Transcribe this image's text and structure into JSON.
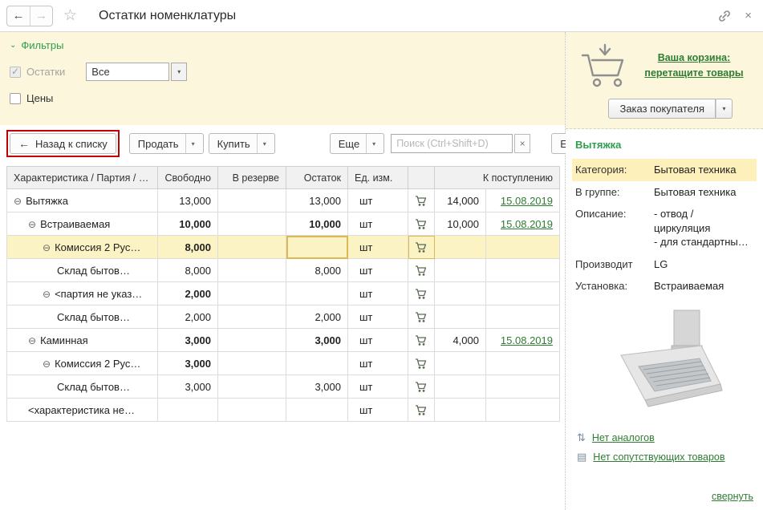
{
  "topbar": {
    "title": "Остатки номенклатуры"
  },
  "filters": {
    "title": "Фильтры",
    "remainders_label": "Остатки",
    "remainders_value": "Все",
    "prices_label": "Цены"
  },
  "toolbar": {
    "back_button": "Назад к списку",
    "sell_button": "Продать",
    "buy_button": "Купить",
    "more_button": "Еще",
    "search_placeholder": "Поиск (Ctrl+Shift+D)",
    "more_button_2": "Еще"
  },
  "table": {
    "columns": {
      "name": "Характеристика / Партия / …",
      "free": "Свободно",
      "reserve": "В резерве",
      "rest": "Остаток",
      "unit": "Ед. изм.",
      "incoming": "К поступлению"
    },
    "rows": [
      {
        "name": "Вытяжка",
        "free": "13,000",
        "reserve": "",
        "rest": "13,000",
        "unit": "шт",
        "incoming": "14,000",
        "date": "15.08.2019"
      },
      {
        "name": "Встраиваемая",
        "free": "10,000",
        "reserve": "",
        "rest": "10,000",
        "unit": "шт",
        "incoming": "10,000",
        "date": "15.08.2019"
      },
      {
        "name": "Комиссия 2 Рус…",
        "free": "8,000",
        "reserve": "",
        "rest": "",
        "unit": "шт",
        "incoming": "",
        "date": ""
      },
      {
        "name": "Склад бытов…",
        "free": "8,000",
        "reserve": "",
        "rest": "8,000",
        "unit": "шт",
        "incoming": "",
        "date": ""
      },
      {
        "name": "<партия не указ…",
        "free": "2,000",
        "reserve": "",
        "rest": "",
        "unit": "шт",
        "incoming": "",
        "date": ""
      },
      {
        "name": "Склад бытов…",
        "free": "2,000",
        "reserve": "",
        "rest": "2,000",
        "unit": "шт",
        "incoming": "",
        "date": ""
      },
      {
        "name": "Каминная",
        "free": "3,000",
        "reserve": "",
        "rest": "3,000",
        "unit": "шт",
        "incoming": "4,000",
        "date": "15.08.2019"
      },
      {
        "name": "Комиссия 2 Рус…",
        "free": "3,000",
        "reserve": "",
        "rest": "",
        "unit": "шт",
        "incoming": "",
        "date": ""
      },
      {
        "name": "Склад бытов…",
        "free": "3,000",
        "reserve": "",
        "rest": "3,000",
        "unit": "шт",
        "incoming": "",
        "date": ""
      },
      {
        "name": "<характеристика не…",
        "free": "",
        "reserve": "",
        "rest": "",
        "unit": "шт",
        "incoming": "",
        "date": ""
      }
    ]
  },
  "cart_panel": {
    "link_line_1": "Ваша корзина:",
    "link_line_2": "перетащите товары",
    "order_button": "Заказ покупателя"
  },
  "product_panel": {
    "title": "Вытяжка",
    "fields": [
      {
        "label": "Категория:",
        "value": "Бытовая техника"
      },
      {
        "label": "В группе:",
        "value": "Бытовая техника"
      },
      {
        "label": "Описание:",
        "value": "- отвод /\nциркуляция\n- для стандартны…"
      },
      {
        "label": "Производит",
        "value": "LG"
      },
      {
        "label": "Установка:",
        "value": "Встраиваемая"
      }
    ],
    "no_analogs_link": "Нет аналогов",
    "no_related_link": "Нет сопутствующих товаров",
    "collapse_link": "свернуть"
  },
  "colors": {
    "accent_green": "#2e9e4e",
    "link_green": "#2e7d32",
    "panel_yellow": "#fcf6dc",
    "selection_yellow": "#fcf3c5",
    "focus_yellow": "#fce28d",
    "annotation_red": "#c00000"
  }
}
